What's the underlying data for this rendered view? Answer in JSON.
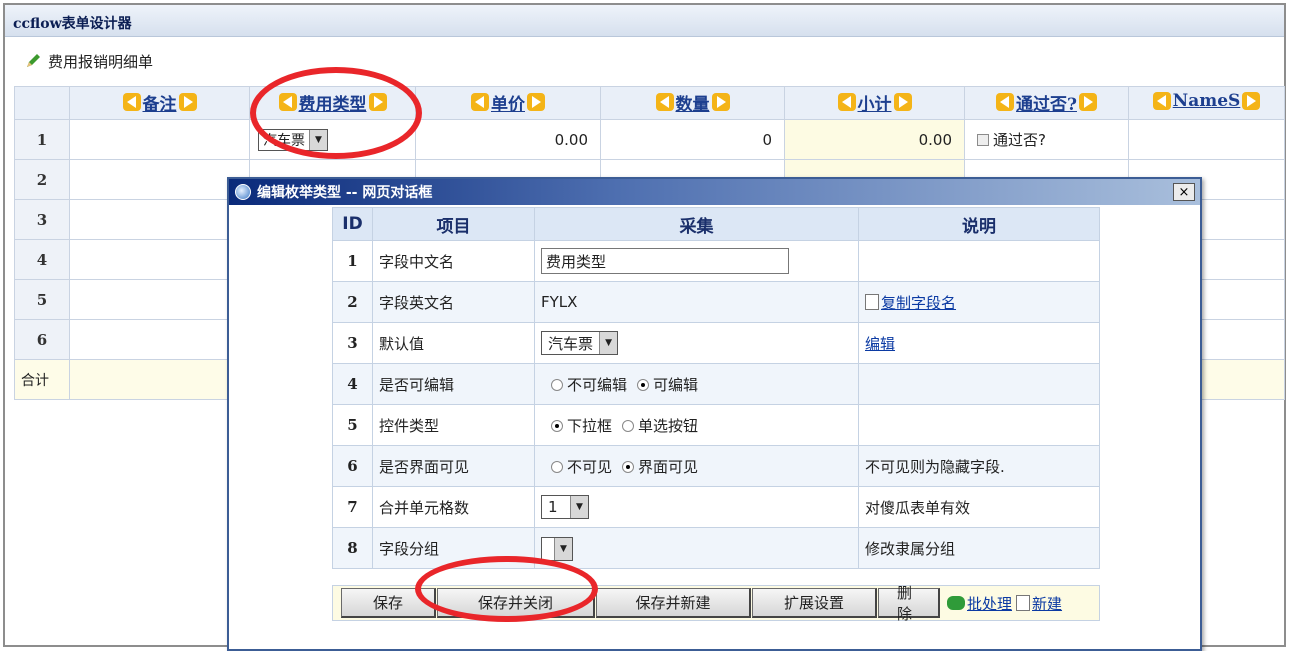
{
  "designer": {
    "title": "ccflow表单设计器",
    "form_caption": "费用报销明细单"
  },
  "grid": {
    "columns": [
      "备注",
      "费用类型",
      "单价",
      "数量",
      "小计",
      "通过否?",
      "NameS"
    ],
    "rows": [
      {
        "no": "1",
        "type_value": "汽车票",
        "price": "0.00",
        "qty": "0",
        "subtotal": "0.00",
        "pass_label": "通过否?"
      },
      {
        "no": "2"
      },
      {
        "no": "3"
      },
      {
        "no": "4"
      },
      {
        "no": "5"
      },
      {
        "no": "6"
      }
    ],
    "total_label": "合计"
  },
  "dialog": {
    "title": "编辑枚举类型 -- 网页对话框",
    "close_label": "×",
    "headers": {
      "id": "ID",
      "item": "项目",
      "collect": "采集",
      "desc": "说明"
    },
    "rows": {
      "r1": {
        "id": "1",
        "item": "字段中文名",
        "value": "费用类型"
      },
      "r2": {
        "id": "2",
        "item": "字段英文名",
        "value": "FYLX",
        "desc": "复制字段名"
      },
      "r3": {
        "id": "3",
        "item": "默认值",
        "value": "汽车票",
        "desc": "编辑"
      },
      "r4": {
        "id": "4",
        "item": "是否可编辑",
        "opt1": "不可编辑",
        "opt2": "可编辑"
      },
      "r5": {
        "id": "5",
        "item": "控件类型",
        "opt1": "下拉框",
        "opt2": "单选按钮"
      },
      "r6": {
        "id": "6",
        "item": "是否界面可见",
        "opt1": "不可见",
        "opt2": "界面可见",
        "desc": "不可见则为隐藏字段."
      },
      "r7": {
        "id": "7",
        "item": "合并单元格数",
        "value": "1",
        "desc": "对傻瓜表单有效"
      },
      "r8": {
        "id": "8",
        "item": "字段分组",
        "value": "",
        "desc": "修改隶属分组"
      }
    },
    "buttons": {
      "save": "保存",
      "save_close": "保存并关闭",
      "save_new": "保存并新建",
      "extend": "扩展设置",
      "delete": "删除",
      "batch": "批处理",
      "new": "新建"
    }
  },
  "colors": {
    "highlight_circle": "#e9262a",
    "header_bg": "#e9eff8",
    "total_bg": "#fefce8"
  }
}
